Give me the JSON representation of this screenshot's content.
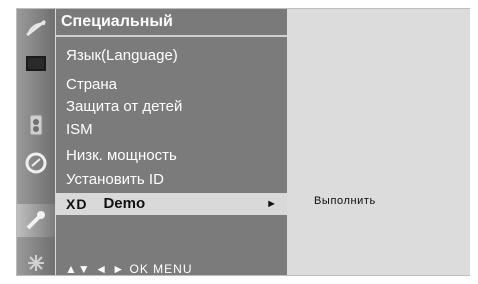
{
  "menu": {
    "title": "Специальный",
    "items": [
      "Язык(Language)",
      "Страна",
      "Защита от детей",
      "ISM",
      "Низк. мощность",
      "Установить ID"
    ],
    "selected": {
      "logo": "XD",
      "label": "Demo",
      "arrow": "►"
    }
  },
  "footer": {
    "hint": "▲▼ ◄ ► OK MENU"
  },
  "submenu": {
    "action": "Выполнить"
  },
  "icons": [
    "satellite-dish-icon",
    "screen-icon",
    "speaker-icon",
    "clock-icon",
    "key-icon",
    "settings-icon"
  ]
}
